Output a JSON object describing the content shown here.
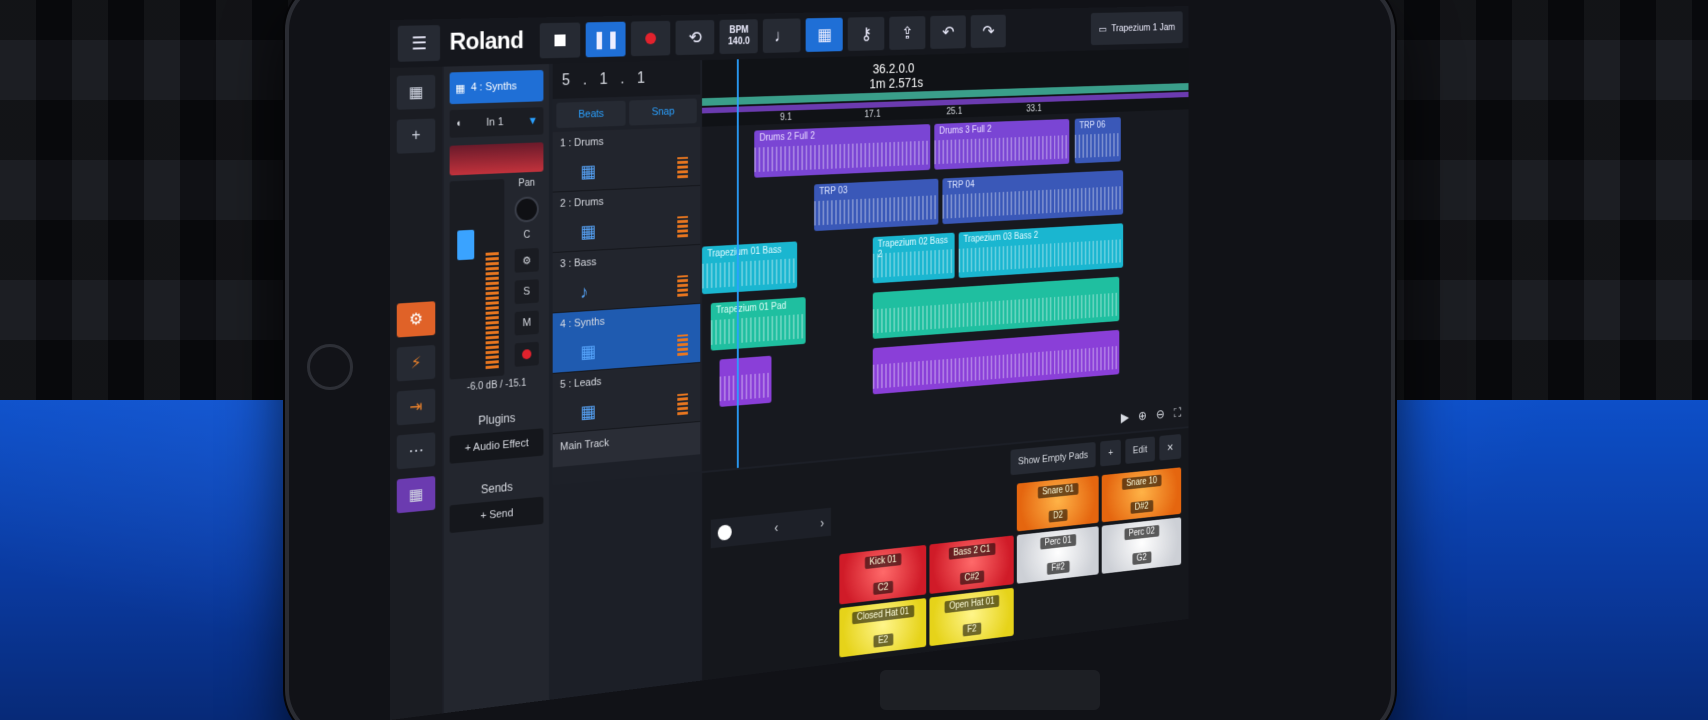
{
  "colors": {
    "accent_blue": "#1f6fd6",
    "record_red": "#e2222d",
    "mixer_orange": "#e06228",
    "desk_blue": "#0d4fc8"
  },
  "toolbar": {
    "menu_icon": "menu-icon",
    "logo": "Roland",
    "bpm_label": "BPM",
    "bpm_value": "140.0",
    "song_name": "Trapezium 1 Jam"
  },
  "inspector": {
    "track_name": "4 : Synths",
    "input": "In 1",
    "pan_label": "Pan",
    "pan_value": "C",
    "solo_label": "S",
    "mute_label": "M",
    "level_readout": "-6.0 dB / -15.1",
    "plugins_heading": "Plugins",
    "add_effect_label": "+ Audio Effect",
    "sends_heading": "Sends",
    "add_send_label": "+ Send"
  },
  "transport": {
    "position": [
      "5",
      "1",
      "1"
    ],
    "beats_label": "Beats",
    "snap_label": "Snap"
  },
  "tracks": [
    {
      "name": "1 : Drums"
    },
    {
      "name": "2 : Drums"
    },
    {
      "name": "3 : Bass"
    },
    {
      "name": "4 : Synths"
    },
    {
      "name": "5 : Leads"
    }
  ],
  "main_track": "Main Track",
  "ruler": {
    "time_bars": "36.2.0.0",
    "time_clock": "1m 2.571s",
    "bars": [
      "9.1",
      "17.1",
      "25.1",
      "33.1"
    ]
  },
  "clips": {
    "drums_full_2": "Drums 2 Full 2",
    "drums_full_3": "Drums 3 Full 2",
    "trp_03": "TRP 03",
    "trp_04": "TRP 04",
    "trp_06": "TRP 06",
    "bass_01": "Trapezium 01 Bass",
    "bass_02": "Trapezium 02 Bass 2",
    "bass_03": "Trapezium 03 Bass 2",
    "pad_01": "Trapezium 01 Pad"
  },
  "pads": {
    "show_empty_label": "Show Empty Pads",
    "add_label": "+",
    "edit_label": "Edit",
    "close_label": "✕",
    "rows": [
      [
        {
          "name": "",
          "note": "",
          "color": "empty"
        },
        {
          "name": "",
          "note": "",
          "color": "empty"
        },
        {
          "name": "Snare 01",
          "note": "D2",
          "color": "orange"
        },
        {
          "name": "Snare 10",
          "note": "D#2",
          "color": "orange"
        }
      ],
      [
        {
          "name": "Kick 01",
          "note": "C2",
          "color": "red"
        },
        {
          "name": "Bass 2 C1",
          "note": "C#2",
          "color": "red"
        },
        {
          "name": "Perc 01",
          "note": "F#2",
          "color": "white"
        },
        {
          "name": "Perc 02",
          "note": "G2",
          "color": "white"
        }
      ],
      [
        {
          "name": "Closed Hat 01",
          "note": "E2",
          "color": "yellow"
        },
        {
          "name": "Open Hat 01",
          "note": "F2",
          "color": "yellow"
        },
        {
          "name": "",
          "note": "",
          "color": "empty"
        },
        {
          "name": "",
          "note": "",
          "color": "empty"
        }
      ]
    ]
  }
}
